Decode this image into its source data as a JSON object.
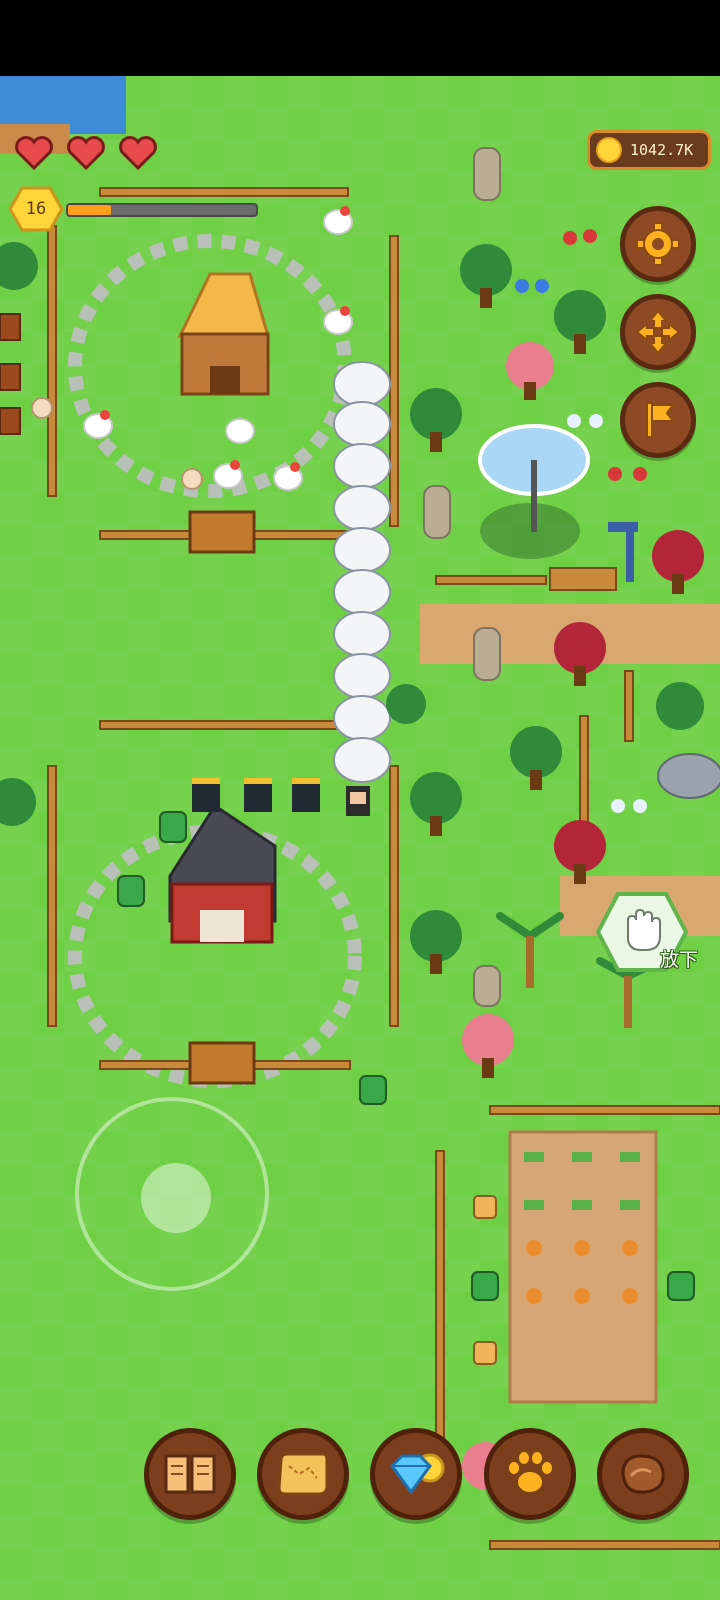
{
  "hud": {
    "hearts": 3,
    "level": "16",
    "xp_progress": 0.23,
    "coins": "1042.7K"
  },
  "side_buttons": [
    {
      "name": "settings",
      "icon": "gear-icon"
    },
    {
      "name": "move",
      "icon": "move-arrows-icon"
    },
    {
      "name": "quest",
      "icon": "flag-icon"
    }
  ],
  "drop_action": {
    "label": "放下",
    "icon": "hand-icon"
  },
  "bottom_bar": [
    {
      "name": "journal",
      "icon": "book-icon"
    },
    {
      "name": "map",
      "icon": "map-scroll-icon"
    },
    {
      "name": "shop",
      "icon": "gem-coin-icon"
    },
    {
      "name": "pets",
      "icon": "paw-icon"
    },
    {
      "name": "materials",
      "icon": "leather-icon"
    }
  ],
  "colors": {
    "grass": "#6fcf45",
    "water": "#3d8bd6",
    "ui_brown": "#8d4a24",
    "ui_orange": "#ff9f1c",
    "gold": "#ffd43a"
  }
}
